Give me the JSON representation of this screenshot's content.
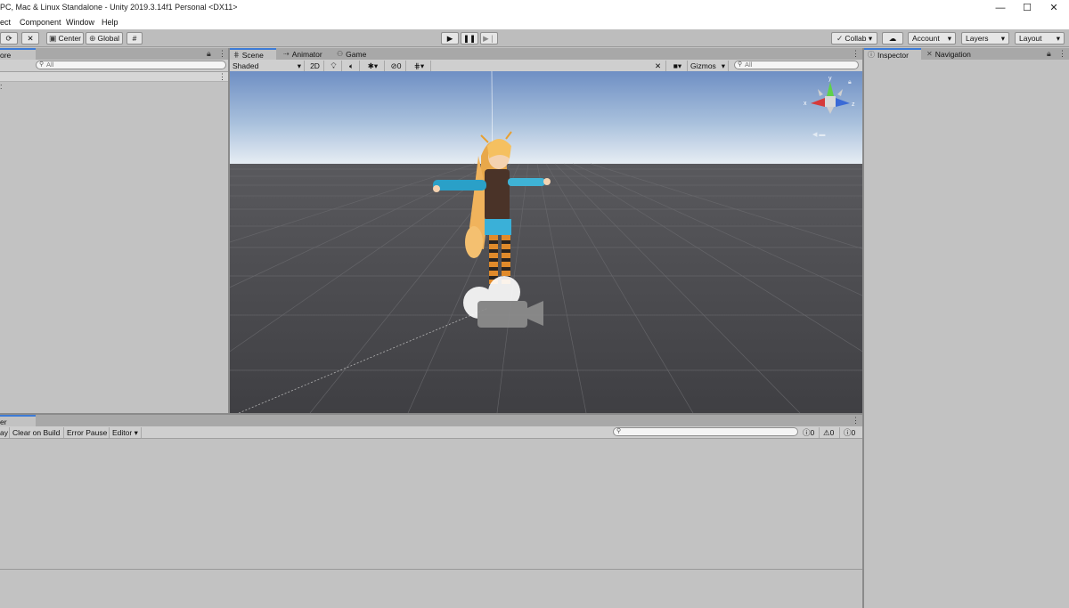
{
  "window": {
    "title": "PC, Mac & Linux Standalone - Unity 2019.3.14f1 Personal <DX11>",
    "minimize": "—",
    "maximize": "☐",
    "close": "✕"
  },
  "menu": [
    "ect",
    "Component",
    "Window",
    "Help"
  ],
  "toolbar": {
    "pivot": "Center",
    "space": "Global",
    "collab": "Collab ▾",
    "account": "Account",
    "layers": "Layers",
    "layout": "Layout"
  },
  "hierarchy": {
    "tab": "ore",
    "search_placeholder": "All"
  },
  "scene": {
    "tabs": [
      "Scene",
      "Animator",
      "Game"
    ],
    "shading": "Shaded",
    "mode_2d": "2D",
    "hidden_count": "0",
    "gizmos": "Gizmos",
    "search_placeholder": "All"
  },
  "gizmo_axes": {
    "x": "x",
    "y": "y",
    "z": "z"
  },
  "inspector": {
    "tabs": [
      "Inspector",
      "Navigation"
    ]
  },
  "console": {
    "tab": "er",
    "buttons": [
      "ay",
      "Clear on Build",
      "Error Pause",
      "Editor ▾"
    ],
    "counts": {
      "info": "0",
      "warning": "0",
      "error": "0"
    }
  },
  "colors": {
    "sky_top": "#6e8fc4",
    "sky_horizon": "#e8eef4",
    "ground": "#4a4a4e",
    "panel": "#c2c2c2",
    "active_tab_accent": "#3d7bd6"
  }
}
